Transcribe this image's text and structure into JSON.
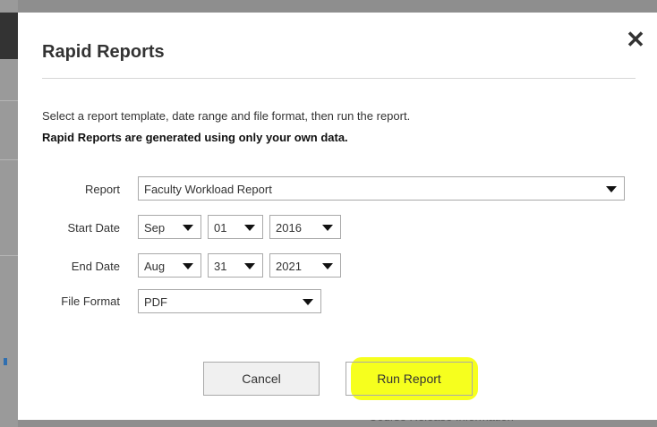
{
  "dialog": {
    "title": "Rapid Reports",
    "description": "Select a report template, date range and file format, then run the report.",
    "note": "Rapid Reports are generated using only your own data."
  },
  "form": {
    "report": {
      "label": "Report",
      "value": "Faculty Workload Report"
    },
    "start_date": {
      "label": "Start Date",
      "month": "Sep",
      "day": "01",
      "year": "2016"
    },
    "end_date": {
      "label": "End Date",
      "month": "Aug",
      "day": "31",
      "year": "2021"
    },
    "file_format": {
      "label": "File Format",
      "value": "PDF"
    }
  },
  "buttons": {
    "cancel": "Cancel",
    "run": "Run Report"
  },
  "icons": {
    "close": "close-icon",
    "dropdown": "caret-down-icon"
  },
  "colors": {
    "highlight": "#f6ff1e"
  },
  "background": {
    "bottom_text": "Course Release Information"
  }
}
